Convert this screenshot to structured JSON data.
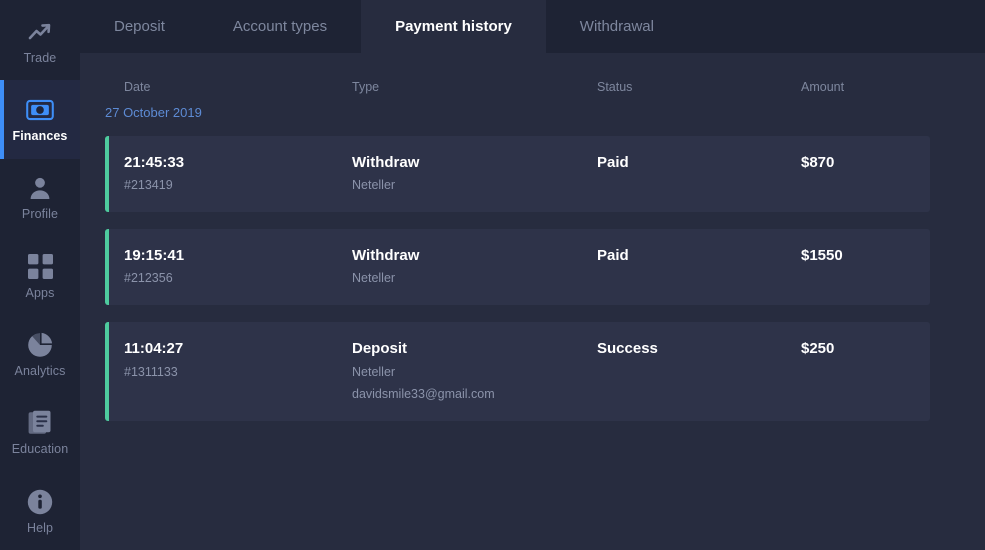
{
  "colors": {
    "sidebar_bg": "#1e2334",
    "main_bg": "#272c3f",
    "row_bg": "#2e3349",
    "accent_blue": "#3e8ef7",
    "accent_green": "#4ecb9e",
    "date_blue": "#5d8bd4",
    "muted_text": "#7e879e"
  },
  "sidebar": {
    "items": [
      {
        "label": "Trade",
        "icon": "trend-up-icon",
        "active": false
      },
      {
        "label": "Finances",
        "icon": "banknote-icon",
        "active": true
      },
      {
        "label": "Profile",
        "icon": "user-icon",
        "active": false
      },
      {
        "label": "Apps",
        "icon": "grid-icon",
        "active": false
      },
      {
        "label": "Analytics",
        "icon": "pie-chart-icon",
        "active": false
      },
      {
        "label": "Education",
        "icon": "book-icon",
        "active": false
      },
      {
        "label": "Help",
        "icon": "info-icon",
        "active": false
      }
    ]
  },
  "tabs": [
    {
      "label": "Deposit",
      "active": false
    },
    {
      "label": "Account types",
      "active": false
    },
    {
      "label": "Payment history",
      "active": true
    },
    {
      "label": "Withdrawal",
      "active": false
    }
  ],
  "table": {
    "headers": {
      "date": "Date",
      "type": "Type",
      "status": "Status",
      "amount": "Amount"
    },
    "date_group": "27 October 2019",
    "rows": [
      {
        "time": "21:45:33",
        "id": "#213419",
        "type": "Withdraw",
        "method": "Neteller",
        "email": "",
        "status": "Paid",
        "amount": "$870"
      },
      {
        "time": "19:15:41",
        "id": "#212356",
        "type": "Withdraw",
        "method": "Neteller",
        "email": "",
        "status": "Paid",
        "amount": "$1550"
      },
      {
        "time": "11:04:27",
        "id": "#1311133",
        "type": "Deposit",
        "method": "Neteller",
        "email": "davidsmile33@gmail.com",
        "status": "Success",
        "amount": "$250"
      }
    ]
  }
}
